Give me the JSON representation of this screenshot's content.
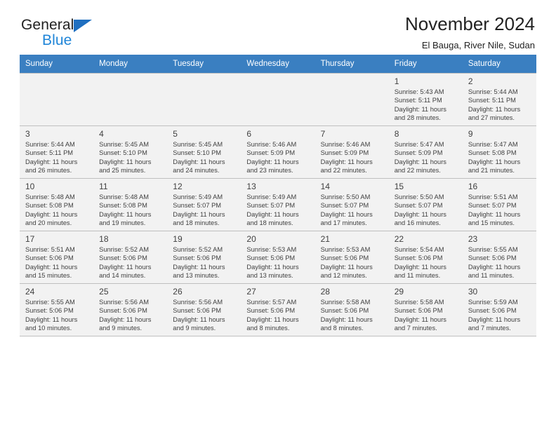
{
  "brand": {
    "word_one": "General",
    "word_two": "Blue",
    "triangle_color": "#1f6fc0"
  },
  "header": {
    "title": "November 2024",
    "subtitle": "El Bauga, River Nile, Sudan",
    "header_bg": "#3a7fc1"
  },
  "calendar": {
    "weekdays": [
      "Sunday",
      "Monday",
      "Tuesday",
      "Wednesday",
      "Thursday",
      "Friday",
      "Saturday"
    ],
    "weeks": [
      [
        {
          "day": "",
          "sunrise": "",
          "sunset": "",
          "daylight": "",
          "empty": true
        },
        {
          "day": "",
          "sunrise": "",
          "sunset": "",
          "daylight": "",
          "empty": true
        },
        {
          "day": "",
          "sunrise": "",
          "sunset": "",
          "daylight": "",
          "empty": true
        },
        {
          "day": "",
          "sunrise": "",
          "sunset": "",
          "daylight": "",
          "empty": true
        },
        {
          "day": "",
          "sunrise": "",
          "sunset": "",
          "daylight": "",
          "empty": true
        },
        {
          "day": "1",
          "sunrise": "Sunrise: 5:43 AM",
          "sunset": "Sunset: 5:11 PM",
          "daylight": "Daylight: 11 hours and 28 minutes.",
          "empty": false
        },
        {
          "day": "2",
          "sunrise": "Sunrise: 5:44 AM",
          "sunset": "Sunset: 5:11 PM",
          "daylight": "Daylight: 11 hours and 27 minutes.",
          "empty": false
        }
      ],
      [
        {
          "day": "3",
          "sunrise": "Sunrise: 5:44 AM",
          "sunset": "Sunset: 5:11 PM",
          "daylight": "Daylight: 11 hours and 26 minutes.",
          "empty": false
        },
        {
          "day": "4",
          "sunrise": "Sunrise: 5:45 AM",
          "sunset": "Sunset: 5:10 PM",
          "daylight": "Daylight: 11 hours and 25 minutes.",
          "empty": false
        },
        {
          "day": "5",
          "sunrise": "Sunrise: 5:45 AM",
          "sunset": "Sunset: 5:10 PM",
          "daylight": "Daylight: 11 hours and 24 minutes.",
          "empty": false
        },
        {
          "day": "6",
          "sunrise": "Sunrise: 5:46 AM",
          "sunset": "Sunset: 5:09 PM",
          "daylight": "Daylight: 11 hours and 23 minutes.",
          "empty": false
        },
        {
          "day": "7",
          "sunrise": "Sunrise: 5:46 AM",
          "sunset": "Sunset: 5:09 PM",
          "daylight": "Daylight: 11 hours and 22 minutes.",
          "empty": false
        },
        {
          "day": "8",
          "sunrise": "Sunrise: 5:47 AM",
          "sunset": "Sunset: 5:09 PM",
          "daylight": "Daylight: 11 hours and 22 minutes.",
          "empty": false
        },
        {
          "day": "9",
          "sunrise": "Sunrise: 5:47 AM",
          "sunset": "Sunset: 5:08 PM",
          "daylight": "Daylight: 11 hours and 21 minutes.",
          "empty": false
        }
      ],
      [
        {
          "day": "10",
          "sunrise": "Sunrise: 5:48 AM",
          "sunset": "Sunset: 5:08 PM",
          "daylight": "Daylight: 11 hours and 20 minutes.",
          "empty": false
        },
        {
          "day": "11",
          "sunrise": "Sunrise: 5:48 AM",
          "sunset": "Sunset: 5:08 PM",
          "daylight": "Daylight: 11 hours and 19 minutes.",
          "empty": false
        },
        {
          "day": "12",
          "sunrise": "Sunrise: 5:49 AM",
          "sunset": "Sunset: 5:07 PM",
          "daylight": "Daylight: 11 hours and 18 minutes.",
          "empty": false
        },
        {
          "day": "13",
          "sunrise": "Sunrise: 5:49 AM",
          "sunset": "Sunset: 5:07 PM",
          "daylight": "Daylight: 11 hours and 18 minutes.",
          "empty": false
        },
        {
          "day": "14",
          "sunrise": "Sunrise: 5:50 AM",
          "sunset": "Sunset: 5:07 PM",
          "daylight": "Daylight: 11 hours and 17 minutes.",
          "empty": false
        },
        {
          "day": "15",
          "sunrise": "Sunrise: 5:50 AM",
          "sunset": "Sunset: 5:07 PM",
          "daylight": "Daylight: 11 hours and 16 minutes.",
          "empty": false
        },
        {
          "day": "16",
          "sunrise": "Sunrise: 5:51 AM",
          "sunset": "Sunset: 5:07 PM",
          "daylight": "Daylight: 11 hours and 15 minutes.",
          "empty": false
        }
      ],
      [
        {
          "day": "17",
          "sunrise": "Sunrise: 5:51 AM",
          "sunset": "Sunset: 5:06 PM",
          "daylight": "Daylight: 11 hours and 15 minutes.",
          "empty": false
        },
        {
          "day": "18",
          "sunrise": "Sunrise: 5:52 AM",
          "sunset": "Sunset: 5:06 PM",
          "daylight": "Daylight: 11 hours and 14 minutes.",
          "empty": false
        },
        {
          "day": "19",
          "sunrise": "Sunrise: 5:52 AM",
          "sunset": "Sunset: 5:06 PM",
          "daylight": "Daylight: 11 hours and 13 minutes.",
          "empty": false
        },
        {
          "day": "20",
          "sunrise": "Sunrise: 5:53 AM",
          "sunset": "Sunset: 5:06 PM",
          "daylight": "Daylight: 11 hours and 13 minutes.",
          "empty": false
        },
        {
          "day": "21",
          "sunrise": "Sunrise: 5:53 AM",
          "sunset": "Sunset: 5:06 PM",
          "daylight": "Daylight: 11 hours and 12 minutes.",
          "empty": false
        },
        {
          "day": "22",
          "sunrise": "Sunrise: 5:54 AM",
          "sunset": "Sunset: 5:06 PM",
          "daylight": "Daylight: 11 hours and 11 minutes.",
          "empty": false
        },
        {
          "day": "23",
          "sunrise": "Sunrise: 5:55 AM",
          "sunset": "Sunset: 5:06 PM",
          "daylight": "Daylight: 11 hours and 11 minutes.",
          "empty": false
        }
      ],
      [
        {
          "day": "24",
          "sunrise": "Sunrise: 5:55 AM",
          "sunset": "Sunset: 5:06 PM",
          "daylight": "Daylight: 11 hours and 10 minutes.",
          "empty": false
        },
        {
          "day": "25",
          "sunrise": "Sunrise: 5:56 AM",
          "sunset": "Sunset: 5:06 PM",
          "daylight": "Daylight: 11 hours and 9 minutes.",
          "empty": false
        },
        {
          "day": "26",
          "sunrise": "Sunrise: 5:56 AM",
          "sunset": "Sunset: 5:06 PM",
          "daylight": "Daylight: 11 hours and 9 minutes.",
          "empty": false
        },
        {
          "day": "27",
          "sunrise": "Sunrise: 5:57 AM",
          "sunset": "Sunset: 5:06 PM",
          "daylight": "Daylight: 11 hours and 8 minutes.",
          "empty": false
        },
        {
          "day": "28",
          "sunrise": "Sunrise: 5:58 AM",
          "sunset": "Sunset: 5:06 PM",
          "daylight": "Daylight: 11 hours and 8 minutes.",
          "empty": false
        },
        {
          "day": "29",
          "sunrise": "Sunrise: 5:58 AM",
          "sunset": "Sunset: 5:06 PM",
          "daylight": "Daylight: 11 hours and 7 minutes.",
          "empty": false
        },
        {
          "day": "30",
          "sunrise": "Sunrise: 5:59 AM",
          "sunset": "Sunset: 5:06 PM",
          "daylight": "Daylight: 11 hours and 7 minutes.",
          "empty": false
        }
      ]
    ]
  }
}
